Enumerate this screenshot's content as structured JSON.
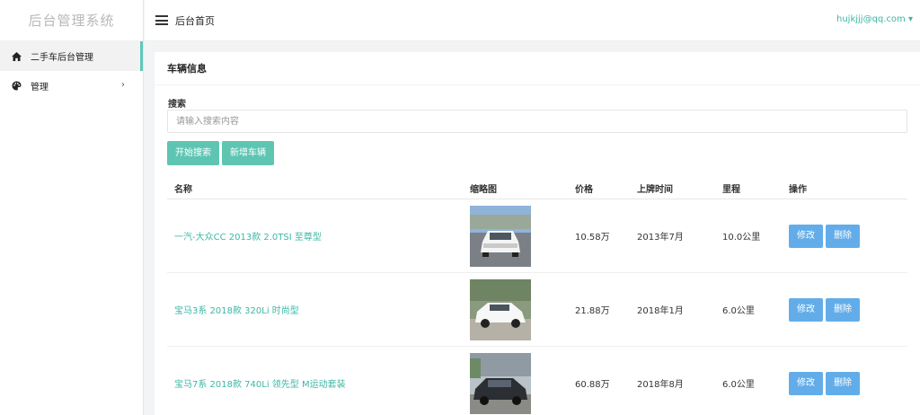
{
  "sidebar": {
    "logo": "后台管理系统",
    "items": [
      {
        "label": "二手车后台管理",
        "icon": "home-icon",
        "active": true
      },
      {
        "label": "管理",
        "icon": "palette-icon",
        "arrow": "›"
      }
    ]
  },
  "header": {
    "title": "后台首页",
    "user": "hujkjjj@qq.com ▾"
  },
  "panel": {
    "title": "车辆信息",
    "search_label": "搜索",
    "search_placeholder": "请输入搜索内容",
    "search_button": "开始搜索",
    "add_button": "新增车辆"
  },
  "table": {
    "headers": {
      "name": "名称",
      "thumb": "缩略图",
      "price": "价格",
      "date": "上牌时间",
      "mileage": "里程",
      "ops": "操作"
    },
    "rows": [
      {
        "name": "一汽-大众CC 2013款 2.0TSI 至尊型",
        "price": "10.58万",
        "date": "2013年7月",
        "mileage": "10.0公里",
        "edit": "修改",
        "delete": "删除"
      },
      {
        "name": "宝马3系 2018款 320Li 时尚型",
        "price": "21.88万",
        "date": "2018年1月",
        "mileage": "6.0公里",
        "edit": "修改",
        "delete": "删除"
      },
      {
        "name": "宝马7系 2018款 740Li 领先型 M运动套装",
        "price": "60.88万",
        "date": "2018年8月",
        "mileage": "6.0公里",
        "edit": "修改",
        "delete": "删除"
      }
    ]
  },
  "colors": {
    "accent": "#5ec5b3",
    "link": "#3bb7a6",
    "op_button": "#62ade9"
  }
}
